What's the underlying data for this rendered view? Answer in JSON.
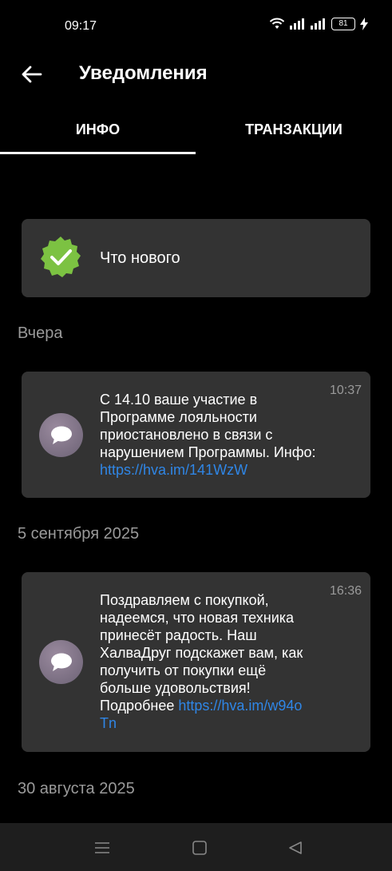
{
  "status": {
    "time": "09:17",
    "battery": "81"
  },
  "header": {
    "title": "Уведомления"
  },
  "tabs": [
    {
      "label": "ИНФО"
    },
    {
      "label": "ТРАНЗАКЦИИ"
    }
  ],
  "whats_new": {
    "label": "Что нового"
  },
  "groups": [
    {
      "date": "Вчера",
      "messages": [
        {
          "time": "10:37",
          "text": "С 14.10 ваше участие в Программе лояльности приостановлено в связи с нарушением Программы. Инфо: ",
          "link": "https://hva.im/141WzW"
        }
      ]
    },
    {
      "date": "5 сентября 2025",
      "messages": [
        {
          "time": "16:36",
          "text": "Поздравляем с покупкой, надеемся, что новая техника принесёт радость. Наш ХалваДруг подскажет вам, как получить от покупки ещё больше удовольствия! Подробнее ",
          "link": "https://hva.im/w94oTn"
        }
      ]
    },
    {
      "date": "30 августа 2025",
      "messages": []
    }
  ],
  "colors": {
    "link": "#2f86e6",
    "card_bg": "#333333",
    "badge_green": "#7cc242",
    "muted_text": "#9a9a9a"
  }
}
